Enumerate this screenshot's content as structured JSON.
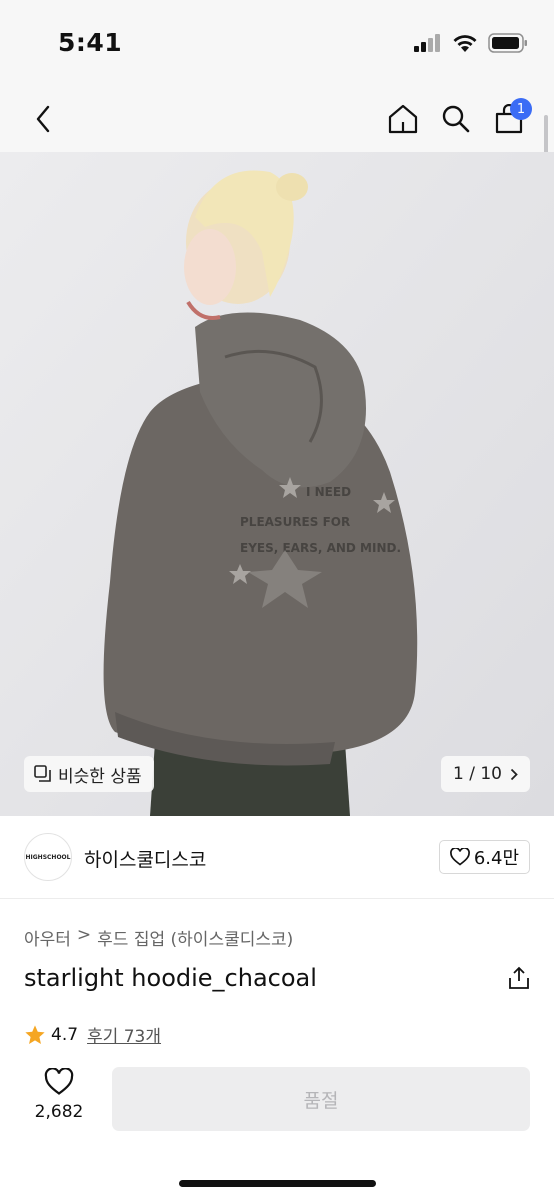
{
  "status": {
    "time": "5:41"
  },
  "nav": {
    "cart_count": "1"
  },
  "gallery": {
    "similar_label": "비슷한 상품",
    "counter": "1 / 10"
  },
  "brand": {
    "name": "하이스쿨디스코",
    "logo_text": "HIGHSCHOOL",
    "likes": "6.4만"
  },
  "breadcrumb": {
    "category": "아우터",
    "separator": ">",
    "subcategory": "후드 집업 (하이스쿨디스코)"
  },
  "product": {
    "title": "starlight hoodie_chacoal",
    "rating": "4.7",
    "reviews": "후기 73개",
    "wish_count": "2,682",
    "status_label": "품절"
  },
  "hoodie_print": {
    "line1": "I NEED",
    "line2": "PLEASURES FOR",
    "line3": "EYES, EARS, AND MIND."
  },
  "colors": {
    "accent": "#3b6cf5",
    "star": "#f5a623",
    "soldout_bg": "#ededee"
  }
}
